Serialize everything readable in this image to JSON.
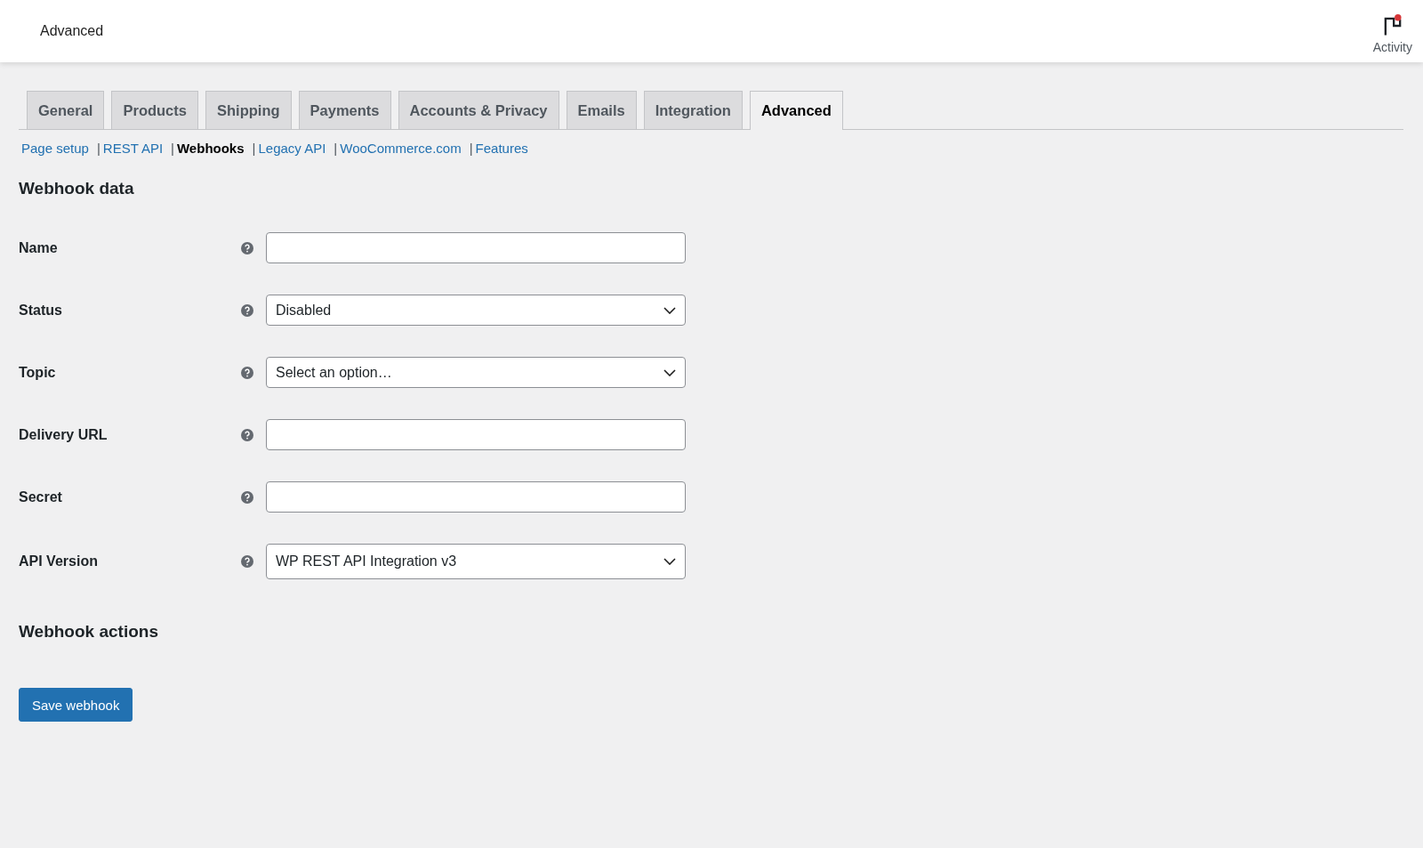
{
  "header": {
    "title": "Advanced",
    "activity": {
      "label": "Activity",
      "unread": true
    }
  },
  "tabs": [
    {
      "label": "General",
      "selected": false
    },
    {
      "label": "Products",
      "selected": false
    },
    {
      "label": "Shipping",
      "selected": false
    },
    {
      "label": "Payments",
      "selected": false
    },
    {
      "label": "Accounts & Privacy",
      "selected": false
    },
    {
      "label": "Emails",
      "selected": false
    },
    {
      "label": "Integration",
      "selected": false
    },
    {
      "label": "Advanced",
      "selected": true
    }
  ],
  "subnav": [
    {
      "label": "Page setup",
      "selected": false
    },
    {
      "separator": "|",
      "label": "REST API",
      "selected": false
    },
    {
      "separator": "|",
      "label": "Webhooks",
      "selected": true
    },
    {
      "separator": "|",
      "label": "Legacy API",
      "selected": false
    },
    {
      "separator": "|",
      "label": "WooCommerce.com",
      "selected": false
    },
    {
      "separator": "|",
      "label": "Features",
      "selected": false
    }
  ],
  "webhook_data": {
    "heading": "Webhook data",
    "fields": [
      {
        "label": "Name",
        "kind": "text"
      },
      {
        "label": "Status",
        "kind": "select",
        "value": "Disabled"
      },
      {
        "label": "Topic",
        "kind": "select",
        "value": "Select an option…"
      },
      {
        "label": "Delivery URL",
        "kind": "text"
      },
      {
        "label": "Secret",
        "kind": "text"
      },
      {
        "label": "API Version",
        "kind": "select",
        "value": "WP REST API Integration v3"
      }
    ]
  },
  "webhook_actions": {
    "heading": "Webhook actions",
    "button": "Save webhook"
  }
}
